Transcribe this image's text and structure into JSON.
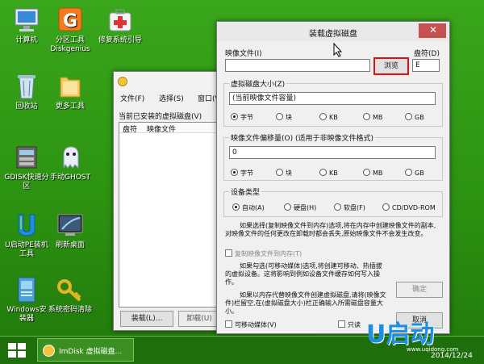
{
  "desktop_icons": [
    {
      "label": "计算机",
      "icon": "computer-icon"
    },
    {
      "label": "分区工具\nDiskgenius",
      "icon": "diskgenius-icon"
    },
    {
      "label": "修复系统引导",
      "icon": "repair-boot-icon"
    },
    {
      "label": "回收站",
      "icon": "recycle-bin-icon"
    },
    {
      "label": "更多工具",
      "icon": "folder-icon"
    },
    {
      "label": "GDISK快速分\n区",
      "icon": "gdisk-icon"
    },
    {
      "label": "手动GHOST",
      "icon": "ghost-icon"
    },
    {
      "label": "U启动PE装机\n工具",
      "icon": "u-install-icon"
    },
    {
      "label": "刷新桌面",
      "icon": "refresh-desktop-icon"
    },
    {
      "label": "Windows安\n装器",
      "icon": "windows-installer-icon"
    },
    {
      "label": "系统密码清除",
      "icon": "key-icon"
    }
  ],
  "imdisk_window": {
    "menu": [
      "文件(F)",
      "选择(S)",
      "窗口(W)"
    ],
    "list_title": "当前已安装的虚拟磁盘(V)",
    "columns": [
      "盘符",
      "映像文件"
    ],
    "mount_button": "装载(L)...",
    "unmount_button": "卸载(U)"
  },
  "mount_dialog": {
    "title": "装载虚拟磁盘",
    "image_file_label": "映像文件(I)",
    "image_file_value": "",
    "browse_button": "浏览",
    "drive_letter_label": "盘符(D)",
    "drive_letter_value": "E",
    "size_group": "虚拟磁盘大小(Z)",
    "size_value": "(当前映像文件容量)",
    "units": [
      "字节",
      "块",
      "KB",
      "MB",
      "GB"
    ],
    "offset_group": "映像文件偏移量(O) (适用于非映像文件格式)",
    "offset_value": "0",
    "device_group": "设备类型",
    "device_types": [
      "自动(A)",
      "硬盘(H)",
      "软盘(F)",
      "CD/DVD-ROM"
    ],
    "note1": "如果选择(复制映像文件到内存)选项,将在内存中创建映像文件的副本,对映像文件的任何更改在卸载时都会丢失,原始映像文件不会发生改变。",
    "copy_to_memory": "复制映像文件到内存(T)",
    "note2": "如果勾选(可移动媒体)选项,将创建可移动、热插拔的虚拟设备。这将影响到例如设备文件缓存如何写入操作。",
    "note3": "如果以内存代替映像文件创建虚拟磁盘,请将(映像文件)栏留空,在(虚拟磁盘大小)栏正确输入所需磁盘容量大小。",
    "ok_button": "确定",
    "cancel_button": "取消",
    "removable_media": "可移动媒体(V)",
    "readonly_media": "只读"
  },
  "taskbar": {
    "task_label": "ImDisk 虚拟磁盘...",
    "date": "2014/12/24",
    "brand": "U启动",
    "brand_url": "www.uqidong.com"
  }
}
